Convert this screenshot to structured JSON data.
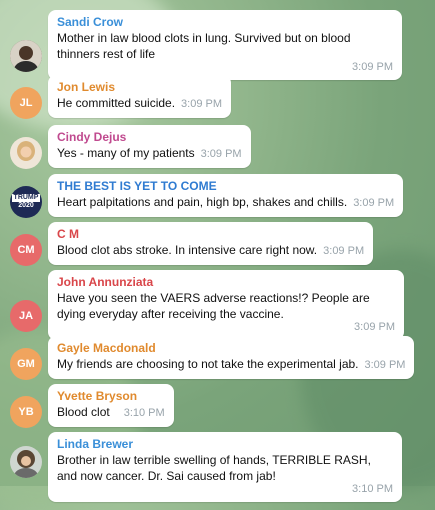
{
  "messages": [
    {
      "author": "Sandi Crow",
      "initials": "",
      "text": "Mother in law blood clots in lung. Survived but on blood thinners rest of life",
      "time": "3:09 PM",
      "name_color": "#3a8fd8",
      "avatar_color": "#5b4a3e"
    },
    {
      "author": "Jon Lewis",
      "initials": "JL",
      "text": "He committed suicide.",
      "time": "3:09 PM",
      "name_color": "#e08a2e",
      "avatar_color": "#f0a45e"
    },
    {
      "author": "Cindy Dejus",
      "initials": "",
      "text": "Yes - many of my patients",
      "time": "3:09 PM",
      "name_color": "#c04a8f",
      "avatar_color": "#d9b08c"
    },
    {
      "author": "THE BEST IS YET TO COME",
      "initials": "",
      "text": "Heart palpitations and pain, high bp, shakes and chills.",
      "time": "3:09 PM",
      "name_color": "#2f7bd1",
      "avatar_color": "#1e2a55"
    },
    {
      "author": "C M",
      "initials": "CM",
      "text": "Blood clot abs stroke. In intensive care right now.",
      "time": "3:09 PM",
      "name_color": "#d9464a",
      "avatar_color": "#e76a6a"
    },
    {
      "author": "John Annunziata",
      "initials": "JA",
      "text": "Have you seen the VAERS adverse reactions!? People are dying everyday after receiving the vaccine.",
      "time": "3:09 PM",
      "name_color": "#d9464a",
      "avatar_color": "#e76a6a"
    },
    {
      "author": "Gayle Macdonald",
      "initials": "GM",
      "text": "My friends are choosing to not take the experimental jab.",
      "time": "3:09 PM",
      "name_color": "#e08a2e",
      "avatar_color": "#f0a45e"
    },
    {
      "author": "Yvette Bryson",
      "initials": "YB",
      "text": "Blood clot",
      "time": "3:10 PM",
      "name_color": "#e08a2e",
      "avatar_color": "#f0a45e"
    },
    {
      "author": "Linda Brewer",
      "initials": "",
      "text": "Brother in law terrible swelling of hands, TERRIBLE RASH, and now cancer. Dr. Sai caused from jab!",
      "time": "3:10 PM",
      "name_color": "#3a8fd8",
      "avatar_color": "#4a4a4a"
    }
  ],
  "trump_badge": {
    "line1": "TRUMP",
    "line2": "2020"
  }
}
